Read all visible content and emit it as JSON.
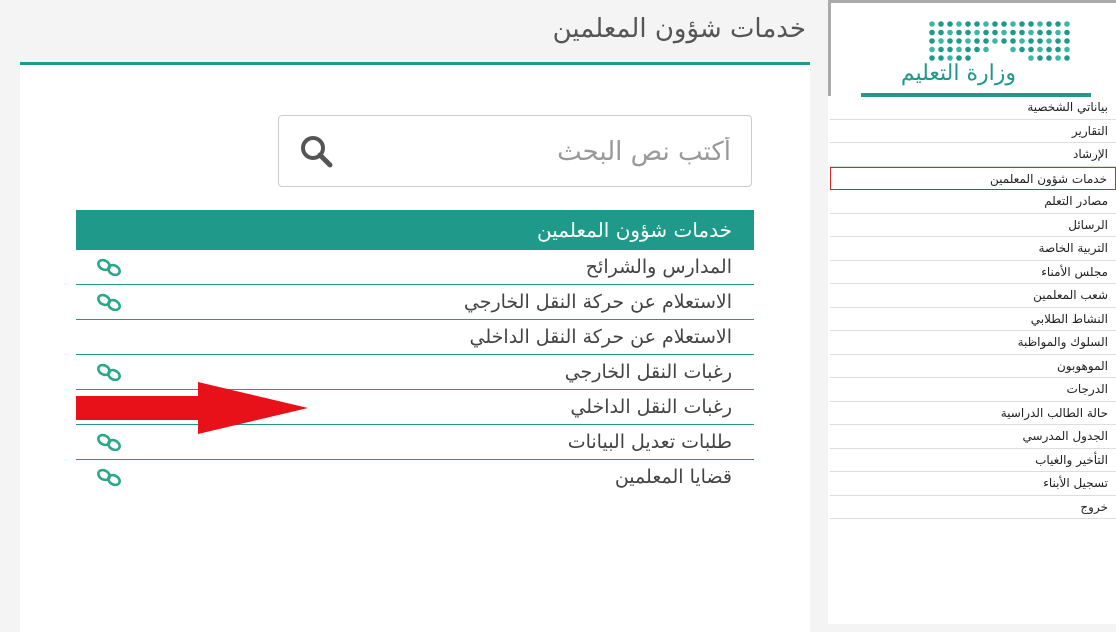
{
  "main": {
    "title": "خدمات شؤون المعلمين",
    "search": {
      "placeholder": "أكتب نص البحث"
    },
    "table": {
      "header": "خدمات شؤون المعلمين",
      "rows": [
        {
          "label": "المدارس والشرائح",
          "has_link_icon": true
        },
        {
          "label": "الاستعلام عن حركة النقل الخارجي",
          "has_link_icon": true
        },
        {
          "label": "الاستعلام عن حركة النقل الداخلي",
          "has_link_icon": false
        },
        {
          "label": "رغبات النقل الخارجي",
          "has_link_icon": true
        },
        {
          "label": "رغبات النقل الداخلي",
          "has_link_icon": true
        },
        {
          "label": "طلبات تعديل البيانات",
          "has_link_icon": true
        },
        {
          "label": "قضايا المعلمين",
          "has_link_icon": true
        }
      ]
    }
  },
  "sidebar": {
    "logo_text": "وزارة التعليم",
    "menu": [
      "بياناتي الشخصية",
      "التقارير",
      "الإرشاد",
      "خدمات شؤون المعلمين",
      "مصادر التعلم",
      "الرسائل",
      "التربية الخاصة",
      "مجلس الأمناء",
      "شعب المعلمين",
      "النشاط الطلابي",
      "السلوك والمواظبة",
      "الموهوبون",
      "الدرجات",
      "حالة الطالب الدراسية",
      "الجدول المدرسي",
      "التأخير والغياب",
      "تسجيل الأبناء",
      "خروج"
    ],
    "active_index": 3
  },
  "colors": {
    "accent": "#1f9a8a",
    "highlight": "#e02424"
  }
}
